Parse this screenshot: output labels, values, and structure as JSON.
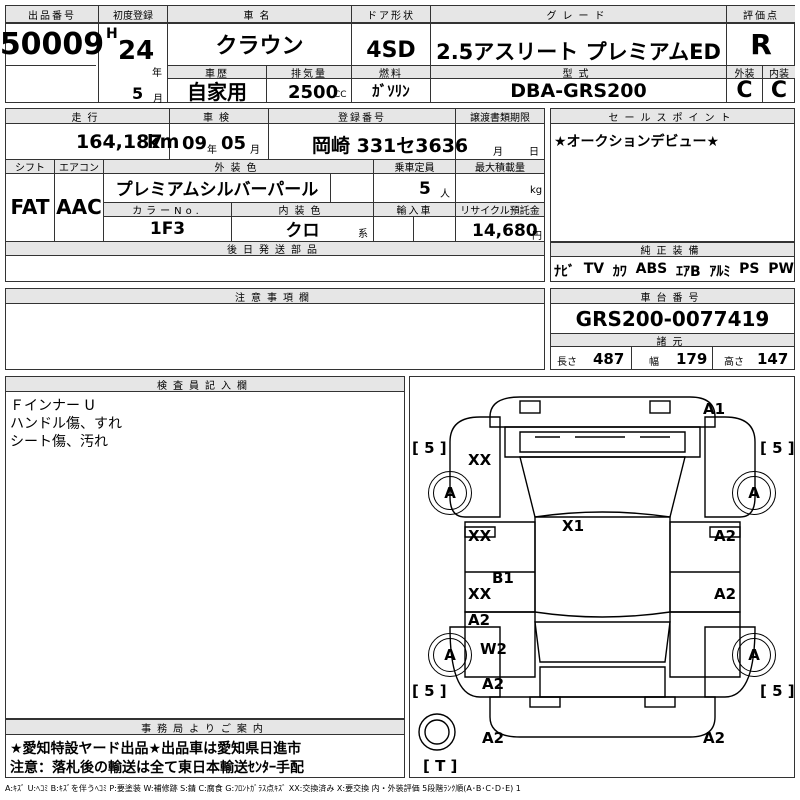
{
  "header": {
    "lot_label": "出品番号",
    "lot_number": "50009",
    "first_reg_label": "初度登録",
    "era": "H",
    "year": "24",
    "year_unit": "年",
    "month": "5",
    "month_unit": "月",
    "car_name_label": "車名",
    "car_name": "クラウン",
    "door_label": "ドア形状",
    "door": "4SD",
    "grade_label": "グレード",
    "grade": "2.5アスリート プレミアムED",
    "score_label": "評価点",
    "score": "R",
    "history_label": "車歴",
    "history": "自家用",
    "displacement_label": "排気量",
    "displacement": "2500",
    "displacement_unit": "CC",
    "fuel_label": "燃料",
    "fuel": "ｶﾞｿﾘﾝ",
    "model_code_label": "型式",
    "model_code": "DBA-GRS200",
    "exterior_label": "外装",
    "exterior": "C",
    "interior_label": "内装",
    "interior": "C"
  },
  "row2": {
    "mileage_label": "走行",
    "mileage": "164,187",
    "mileage_unit": "km",
    "inspection_label": "車検",
    "inspection_year": "09",
    "inspection_year_unit": "年",
    "inspection_month": "05",
    "inspection_month_unit": "月",
    "plate_label": "登録番号",
    "plate": "岡崎 331セ3636",
    "transfer_label": "譲渡書類期限",
    "transfer_month_unit": "月",
    "transfer_day_unit": "日",
    "shift_label": "シフト",
    "shift": "FAT",
    "ac_label": "エアコン",
    "ac": "AAC",
    "ext_color_label": "外装色",
    "ext_color": "プレミアムシルバーパール",
    "capacity_label": "乗車定員",
    "capacity": "5",
    "capacity_unit": "人",
    "max_load_label": "最大積載量",
    "max_load_unit": "kg",
    "color_no_label": "カラーNo.",
    "color_no": "1F3",
    "int_color_label": "内装色",
    "int_color": "クロ",
    "int_color_unit": "系",
    "import_label": "輸入車",
    "recycle_label": "リサイクル預託金",
    "recycle": "14,680",
    "recycle_unit": "円",
    "later_parts_label": "後日発送部品"
  },
  "sales_point": {
    "label": "セールスポイント",
    "text": "★オークションデビュー★"
  },
  "equipment": {
    "label": "純正装備",
    "items": [
      "ﾅﾋﾞ",
      "TV",
      "ｶﾜ",
      "ABS",
      "ｴｱB",
      "ｱﾙﾐ",
      "PS",
      "PW"
    ]
  },
  "notes": {
    "label": "注意事項欄"
  },
  "chassis": {
    "label": "車台番号",
    "number": "GRS200-0077419",
    "dims_label": "諸元",
    "length_label": "長さ",
    "length": "487",
    "width_label": "幅",
    "width": "179",
    "height_label": "高さ",
    "height": "147"
  },
  "inspector": {
    "label": "検査員記入欄",
    "lines": [
      "Ｆインナー U",
      "ハンドル傷、すれ",
      "シート傷、汚れ"
    ]
  },
  "office": {
    "label": "事務局よりご案内",
    "line1": "★愛知特設ヤード出品★出品車は愛知県日進市",
    "line2": "注意：落札後の輸送は全て東日本輸送ｾﾝﾀｰ手配"
  },
  "diagram": {
    "marks": {
      "a1": "A1",
      "xx_top": "XX",
      "x1": "X1",
      "xx_left_front": "XX",
      "a2_right_front": "A2",
      "b1": "B1",
      "xx_left_rear": "XX",
      "a2_right_rear": "A2",
      "a2_left_rear": "A2",
      "w2": "W2",
      "a2_bottom_left": "A2",
      "a2_trunk_left": "A2",
      "a2_trunk_right": "A2"
    },
    "tire_marks": {
      "fl": "A",
      "fr": "A",
      "rl": "A",
      "rr": "A"
    },
    "tread": {
      "fl": "[ 5 ]",
      "fr": "[ 5 ]",
      "rl": "[ 5 ]",
      "rr": "[ 5 ]",
      "spare": "[ T ]"
    }
  },
  "legend": "A:ｷｽﾞ U:ﾍｺﾐ B:ｷｽﾞを伴うﾍｺﾐ P:要塗装 W:補修跡 S:錆 C:腐食 G:ﾌﾛﾝﾄｶﾞﾗｽ点ｷｽﾞ XX:交換済み X:要交換 内・外装評価 5段階ﾗﾝｸ順(A･B･C･D･E) 1"
}
